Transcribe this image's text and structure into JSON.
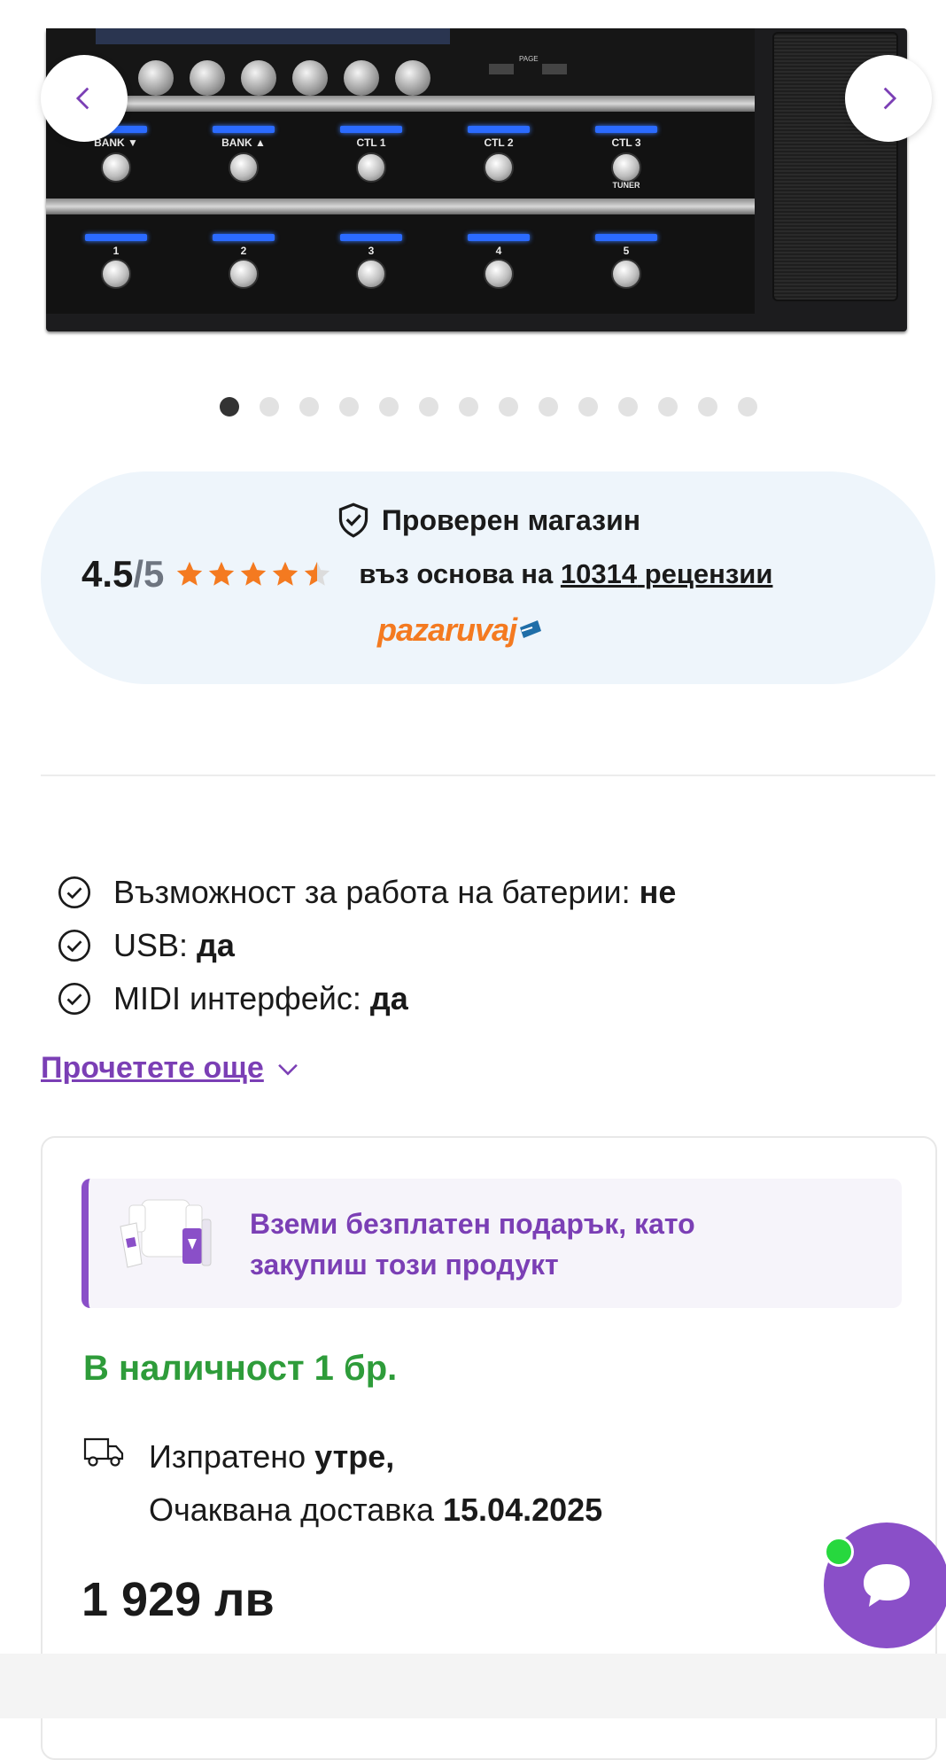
{
  "carousel": {
    "image_alt": "Boss GT-1000 multi-effects pedal",
    "pedal_labels": {
      "row1": [
        "BANK ▼",
        "BANK ▲",
        "CTL 1",
        "CTL 2",
        "CTL 3"
      ],
      "tuner": "TUNER",
      "row2": [
        "1",
        "2",
        "3",
        "4",
        "5"
      ],
      "page": "PAGE"
    },
    "dot_count": 14,
    "active_dot": 0,
    "prev_icon": "chevron-left-icon",
    "next_icon": "chevron-right-icon"
  },
  "verified": {
    "title": "Проверен магазин",
    "rating": "4.5",
    "rating_max": "/5",
    "stars": 4.5,
    "based_prefix": "въз основа на",
    "reviews_count": "10314",
    "reviews_word": "рецензии",
    "logo_text": "pazaruvaj"
  },
  "specs": [
    {
      "label": "Възможност за работа на батерии:",
      "value": "не"
    },
    {
      "label": "USB:",
      "value": "да"
    },
    {
      "label": "MIDI интерфейс:",
      "value": "да"
    }
  ],
  "read_more": "Прочетете още",
  "gift": {
    "line1": "Вземи безплатен подарък, като",
    "line2": "закупиш този продукт"
  },
  "stock": "В наличност 1 бр.",
  "shipping": {
    "sent_prefix": "Изпратено",
    "sent_when": "утре,",
    "delivery_prefix": "Очаквана доставка",
    "delivery_date": "15.04.2025"
  },
  "price": "1 929 лв",
  "colors": {
    "accent": "#7b3fb5",
    "stock_green": "#2e9c3a",
    "star_orange": "#f47a20",
    "card_bg": "#eef5fb"
  }
}
